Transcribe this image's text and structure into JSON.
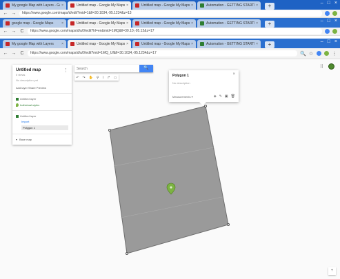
{
  "browser": {
    "window1_tabs": [
      {
        "label": "My google Map with Layers - Google",
        "active": false,
        "fav": "#c62828"
      },
      {
        "label": "Untitled map - Google My Maps",
        "active": true,
        "fav": "#c62828"
      },
      {
        "label": "Untitled map - Google My Maps",
        "active": false,
        "fav": "#c62828"
      },
      {
        "label": "Automation - GETTING STARTED",
        "active": false,
        "fav": "#2e7d32"
      }
    ],
    "window1_url": "https://www.google.com/maps/d/edit?mid=1&ll=30.1034,-95.1234&z=13",
    "window2_tabs": [
      {
        "label": "google map - Google Maps",
        "active": false,
        "fav": "#c62828"
      },
      {
        "label": "Untitled map - Google My Maps",
        "active": true,
        "fav": "#c62828"
      },
      {
        "label": "Untitled map - Google My Maps",
        "active": false,
        "fav": "#c62828"
      },
      {
        "label": "Automation - GETTING STARTED",
        "active": false,
        "fav": "#2e7d32"
      }
    ],
    "window2_url": "https://www.google.com/maps/d/u/0/edit?hl=en&mid=1MQ&ll=30.10,-95.12&z=17",
    "window3_tabs": [
      {
        "label": "My google Map with Layers",
        "active": false,
        "fav": "#c62828"
      },
      {
        "label": "Untitled map - Google My Maps",
        "active": true,
        "fav": "#c62828"
      },
      {
        "label": "Untitled map - Google My Maps",
        "active": false,
        "fav": "#c62828"
      },
      {
        "label": "Automation - GETTING STARTED",
        "active": false,
        "fav": "#2e7d32"
      }
    ],
    "window3_url": "https://www.google.com/maps/d/u/0/edit?mid=1MQ_Uf&ll=30.1034,-95.1234&z=17"
  },
  "panel": {
    "title": "Untitled map",
    "subtitle": "0 views",
    "description": "No description yet",
    "actions": "Add layer  Share  Preview",
    "layer_name": "Untitled layer",
    "layer_style": "Individual styles",
    "sublayer_title": "Untitled layer",
    "sublayer_link": "Import",
    "item_label": "Polygon 1",
    "basemap_label": "Base map"
  },
  "search": {
    "placeholder": "Search",
    "button": "🔍"
  },
  "popup": {
    "title": "Polygon 1",
    "description": "No description",
    "style_label": "Measurements  ▾"
  },
  "colors": {
    "polygon_fill": "#9a9a9a",
    "polygon_stroke": "#6f6f6f",
    "pin": "#7cb342",
    "search_btn": "#4285f4"
  }
}
